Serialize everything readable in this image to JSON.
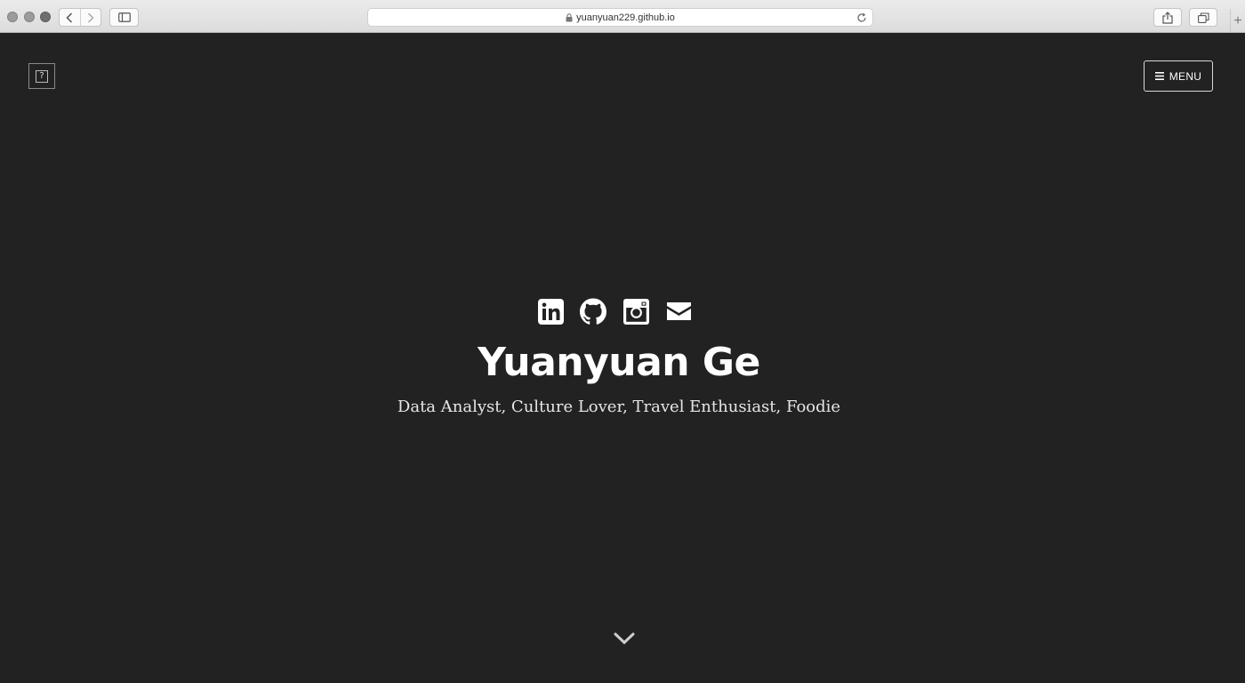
{
  "browser": {
    "url": "yuanyuan229.github.io",
    "new_tab_label": "+"
  },
  "header": {
    "logo_glyph": "?",
    "menu_label": "MENU"
  },
  "hero": {
    "name": "Yuanyuan Ge",
    "tagline": "Data Analyst, Culture Lover, Travel Enthusiast, Foodie",
    "social_icons": [
      "linkedin-icon",
      "github-icon",
      "instagram-icon",
      "email-icon"
    ]
  },
  "colors": {
    "background": "#222222",
    "text": "#ffffff",
    "chrome": "#e4e4e4"
  }
}
